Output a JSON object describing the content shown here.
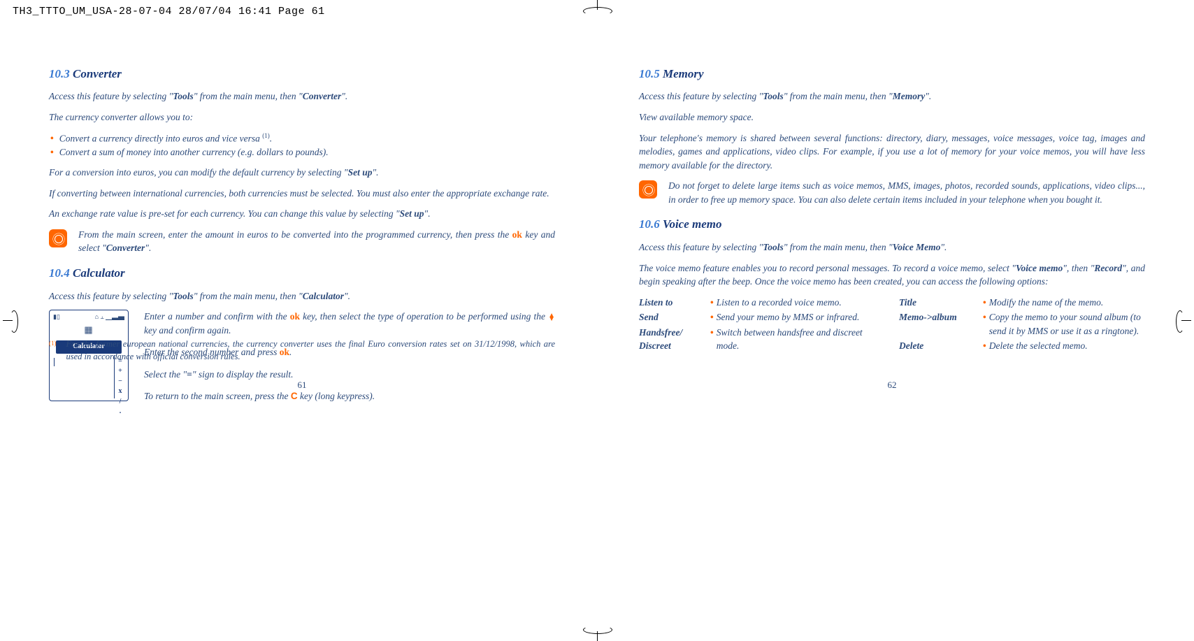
{
  "header": "TH3_TTTO_UM_USA-28-07-04  28/07/04  16:41  Page 61",
  "left": {
    "s103": {
      "num": "10.3",
      "title": "Converter",
      "access_a": "Access this feature by selecting \"",
      "access_b": "Tools",
      "access_c": "\" from the main menu, then \"",
      "access_d": "Converter",
      "access_e": "\".",
      "intro": "The currency converter allows you to:",
      "b1": "Convert a currency directly into euros and vice versa ",
      "b1sup": "(1)",
      "b1end": ".",
      "b2": "Convert a sum of money into another currency (e.g. dollars to pounds).",
      "p1a": "For a conversion into euros, you can modify the default currency by selecting \"",
      "p1b": "Set up",
      "p1c": "\".",
      "p2": "If converting between international currencies, both currencies must be selected. You must also enter the appropriate exchange rate.",
      "p3a": "An exchange rate value is pre-set for each currency. You can change this value by selecting \"",
      "p3b": "Set up",
      "p3c": "\".",
      "tip_a": "From the main screen, enter the amount in euros to be converted into the programmed currency, then press the ",
      "tip_ok": "ok",
      "tip_b": " key and select \"",
      "tip_c": "Converter",
      "tip_d": "\"."
    },
    "s104": {
      "num": "10.4",
      "title": "Calculator",
      "access_a": "Access this feature by selecting \"",
      "access_b": "Tools",
      "access_c": "\" from the main menu, then \"",
      "access_d": "Calculator",
      "access_e": "\".",
      "fig_title": "Calculator",
      "p1a": "Enter a number and confirm with the ",
      "p1ok": "ok",
      "p1b": " key, then select the type of operation to be performed using the ",
      "p1c": " key and confirm again.",
      "p2a": "Enter the second number and press ",
      "p2ok": "ok",
      "p2b": ".",
      "p3a": "Select the \"",
      "p3eq": "=",
      "p3b": "\" sign to display the result.",
      "p4a": "To return to the main screen, press the ",
      "p4c": "C",
      "p4b": " key (long keypress)."
    },
    "footnote_sup": "(1)",
    "footnote": "For the former european national currencies, the currency converter uses the final Euro conversion rates set on 31/12/1998, which are used in accordance with official conversion rules.",
    "pagenum": "61"
  },
  "right": {
    "s105": {
      "num": "10.5",
      "title": "Memory",
      "access_a": "Access this feature by selecting \"",
      "access_b": "Tools",
      "access_c": "\" from the main menu, then \"",
      "access_d": "Memory",
      "access_e": "\".",
      "p1": "View available memory space.",
      "p2": "Your telephone's memory is shared between several functions: directory, diary, messages, voice messages, voice tag, images and melodies, games and applications, video clips. For example, if you use a lot of memory for your voice memos, you will have less memory available for the directory.",
      "tip": "Do not forget to delete large items such as voice memos, MMS, images, photos, recorded sounds, applications, video clips..., in order to free up memory space. You can also delete certain items included in your telephone when you bought it."
    },
    "s106": {
      "num": "10.6",
      "title": "Voice memo",
      "access_a": "Access this feature by selecting \"",
      "access_b": "Tools",
      "access_c": "\" from the main menu, then \"",
      "access_d": "Voice Memo",
      "access_e": "\".",
      "p1a": "The voice memo feature enables you to record personal messages. To record a voice memo, select \"",
      "p1b": "Voice memo",
      "p1c": "\", then \"",
      "p1d": "Record",
      "p1e": "\", and begin speaking after the beep. Once the voice memo has been created, you can access the following options:",
      "opts_left": [
        {
          "label": "Listen to",
          "desc": "Listen to a recorded voice memo."
        },
        {
          "label": "Send",
          "desc": "Send your memo by MMS or infrared."
        },
        {
          "label": "Handsfree/ Discreet",
          "desc": "Switch between handsfree and discreet mode."
        }
      ],
      "opts_right": [
        {
          "label": "Title",
          "desc": "Modify the name of the memo."
        },
        {
          "label": "Memo->album",
          "desc": "Copy the memo to your sound album (to send it by MMS or use it as a ringtone)."
        },
        {
          "label": "Delete",
          "desc": "Delete the selected memo."
        }
      ]
    },
    "pagenum": "62"
  }
}
